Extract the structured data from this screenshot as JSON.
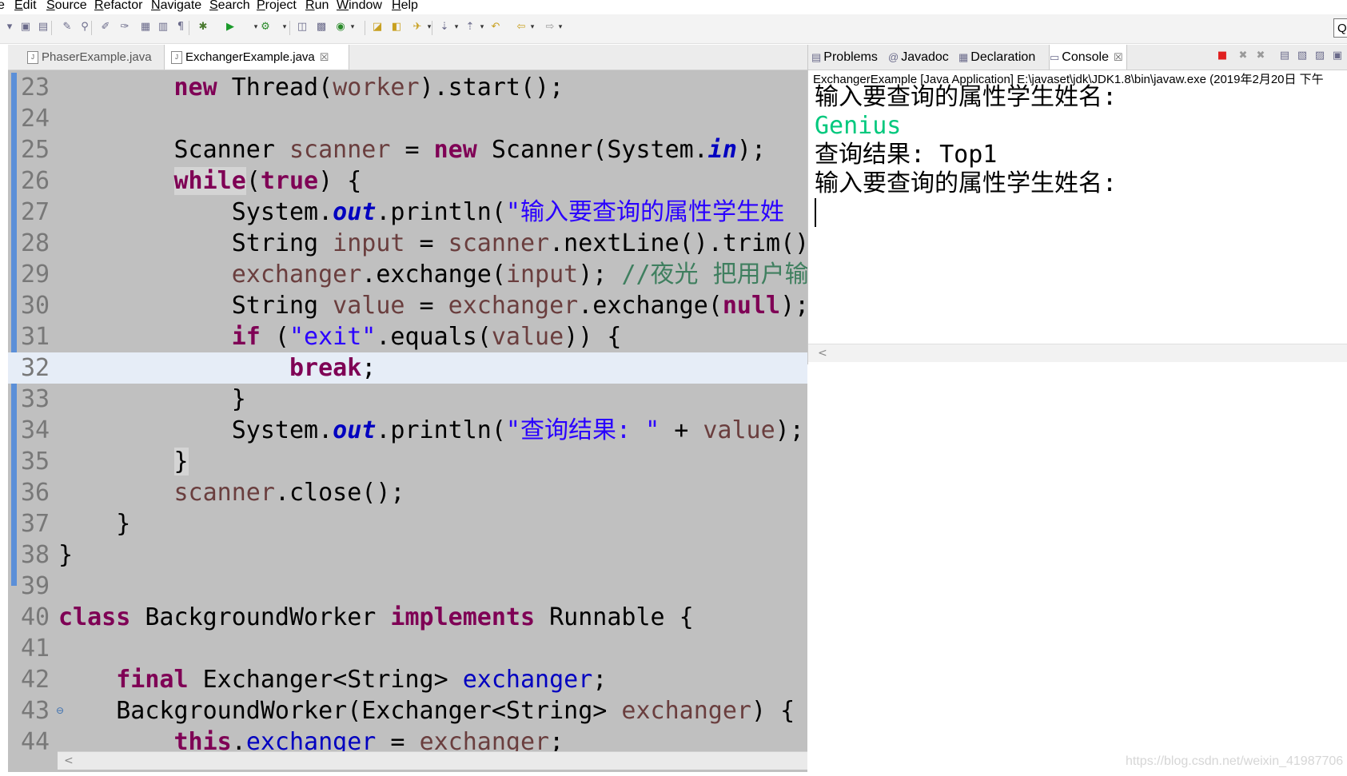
{
  "menu": [
    "e",
    "Edit",
    "Source",
    "Refactor",
    "Navigate",
    "Search",
    "Project",
    "Run",
    "Window",
    "Help"
  ],
  "toolbar": {
    "icons": [
      "dropdown-arrow-icon",
      "save-icon",
      "save-all-icon",
      "toggle-mark-occurrences-icon",
      "pin-icon",
      "highlight-icon",
      "mark-icon",
      "block-selection-icon",
      "show-whitespace-icon",
      "paragraph-icon",
      "debug-icon",
      "run-icon",
      "external-tools-icon",
      "new-java-project-icon",
      "new-package-icon",
      "new-class-icon",
      "open-type-icon",
      "open-task-icon",
      "search-icon",
      "next-annotation-icon",
      "previous-annotation-icon",
      "last-edit-location-icon",
      "back-icon",
      "forward-icon"
    ],
    "quick_access": "Q"
  },
  "editor": {
    "tabs": [
      {
        "label": "PhaserExample.java",
        "active": false
      },
      {
        "label": "ExchangerExample.java",
        "active": true,
        "close": "☒"
      }
    ],
    "lines": [
      {
        "n": "23",
        "parts": [
          {
            "t": "        "
          },
          {
            "t": "new",
            "c": "kw"
          },
          {
            "t": " Thread("
          },
          {
            "t": "worker",
            "c": "var"
          },
          {
            "t": ").start();"
          }
        ]
      },
      {
        "n": "24",
        "parts": []
      },
      {
        "n": "25",
        "parts": [
          {
            "t": "        Scanner "
          },
          {
            "t": "scanner",
            "c": "var"
          },
          {
            "t": " = "
          },
          {
            "t": "new",
            "c": "kw"
          },
          {
            "t": " Scanner(System."
          },
          {
            "t": "in",
            "c": "sfld"
          },
          {
            "t": ");"
          }
        ]
      },
      {
        "n": "26",
        "parts": [
          {
            "t": "        "
          },
          {
            "t": "while",
            "c": "kw hl"
          },
          {
            "t": "("
          },
          {
            "t": "true",
            "c": "kw"
          },
          {
            "t": ") {"
          }
        ]
      },
      {
        "n": "27",
        "parts": [
          {
            "t": "            System."
          },
          {
            "t": "out",
            "c": "sfld"
          },
          {
            "t": ".println("
          },
          {
            "t": "\"输入要查询的属性学生姓",
            "c": "str"
          }
        ]
      },
      {
        "n": "28",
        "parts": [
          {
            "t": "            String "
          },
          {
            "t": "input",
            "c": "var"
          },
          {
            "t": " = "
          },
          {
            "t": "scanner",
            "c": "var"
          },
          {
            "t": ".nextLine().trim()"
          }
        ]
      },
      {
        "n": "29",
        "parts": [
          {
            "t": "            "
          },
          {
            "t": "exchanger",
            "c": "var"
          },
          {
            "t": ".exchange("
          },
          {
            "t": "input",
            "c": "var"
          },
          {
            "t": "); "
          },
          {
            "t": "//夜光 把用户输",
            "c": "cmt"
          }
        ]
      },
      {
        "n": "30",
        "parts": [
          {
            "t": "            String "
          },
          {
            "t": "value",
            "c": "var"
          },
          {
            "t": " = "
          },
          {
            "t": "exchanger",
            "c": "var"
          },
          {
            "t": ".exchange("
          },
          {
            "t": "null",
            "c": "kw"
          },
          {
            "t": ");"
          }
        ]
      },
      {
        "n": "31",
        "parts": [
          {
            "t": "            "
          },
          {
            "t": "if",
            "c": "kw"
          },
          {
            "t": " ("
          },
          {
            "t": "\"exit\"",
            "c": "str"
          },
          {
            "t": ".equals("
          },
          {
            "t": "value",
            "c": "var"
          },
          {
            "t": ")) {"
          }
        ]
      },
      {
        "n": "32",
        "current": true,
        "parts": [
          {
            "t": "                "
          },
          {
            "t": "break",
            "c": "kw"
          },
          {
            "t": ";"
          }
        ]
      },
      {
        "n": "33",
        "parts": [
          {
            "t": "            }"
          }
        ]
      },
      {
        "n": "34",
        "parts": [
          {
            "t": "            System."
          },
          {
            "t": "out",
            "c": "sfld"
          },
          {
            "t": ".println("
          },
          {
            "t": "\"查询结果: \"",
            "c": "str"
          },
          {
            "t": " + "
          },
          {
            "t": "value",
            "c": "var"
          },
          {
            "t": ");"
          }
        ]
      },
      {
        "n": "35",
        "parts": [
          {
            "t": "        "
          },
          {
            "t": "}",
            "c": "hl"
          }
        ]
      },
      {
        "n": "36",
        "parts": [
          {
            "t": "        "
          },
          {
            "t": "scanner",
            "c": "var"
          },
          {
            "t": ".close();"
          }
        ]
      },
      {
        "n": "37",
        "parts": [
          {
            "t": "    }"
          }
        ]
      },
      {
        "n": "38",
        "parts": [
          {
            "t": "}"
          }
        ]
      },
      {
        "n": "39",
        "parts": []
      },
      {
        "n": "40",
        "parts": [
          {
            "t": "class",
            "c": "kw"
          },
          {
            "t": " BackgroundWorker "
          },
          {
            "t": "implements",
            "c": "kw"
          },
          {
            "t": " Runnable {"
          }
        ]
      },
      {
        "n": "41",
        "parts": []
      },
      {
        "n": "42",
        "parts": [
          {
            "t": "    "
          },
          {
            "t": "final",
            "c": "kw"
          },
          {
            "t": " Exchanger<String> "
          },
          {
            "t": "exchanger",
            "c": "fld"
          },
          {
            "t": ";"
          }
        ]
      },
      {
        "n": "43",
        "fold": "⊖",
        "parts": [
          {
            "t": "    BackgroundWorker(Exchanger<String> "
          },
          {
            "t": "exchanger",
            "c": "var"
          },
          {
            "t": ") {"
          }
        ]
      },
      {
        "n": "44",
        "parts": [
          {
            "t": "        "
          },
          {
            "t": "this",
            "c": "kw"
          },
          {
            "t": "."
          },
          {
            "t": "exchanger",
            "c": "fld"
          },
          {
            "t": " = "
          },
          {
            "t": "exchanger",
            "c": "var"
          },
          {
            "t": ";"
          }
        ]
      }
    ],
    "scroll_arrow": "<"
  },
  "console": {
    "tabs": [
      {
        "label": "Problems",
        "icon": "problems-icon",
        "glyph": "▤"
      },
      {
        "label": "Javadoc",
        "icon": "javadoc-icon",
        "glyph": "@"
      },
      {
        "label": "Declaration",
        "icon": "declaration-icon",
        "glyph": "▦"
      },
      {
        "label": "Console",
        "icon": "console-icon",
        "glyph": "▭",
        "active": true,
        "close": "☒"
      }
    ],
    "title": "ExchangerExample [Java Application] E:\\javaset\\jdk\\JDK1.8\\bin\\javaw.exe (2019年2月20日 下午",
    "output": [
      {
        "text": "输入要查询的属性学生姓名:",
        "kind": "out"
      },
      {
        "text": "Genius",
        "kind": "input"
      },
      {
        "text": "查询结果: Top1",
        "kind": "out"
      },
      {
        "text": "输入要查询的属性学生姓名:",
        "kind": "out"
      }
    ],
    "scroll_arrow": "<",
    "terminate_color": "#e02020"
  },
  "watermark": "https://blog.csdn.net/weixin_41987706"
}
